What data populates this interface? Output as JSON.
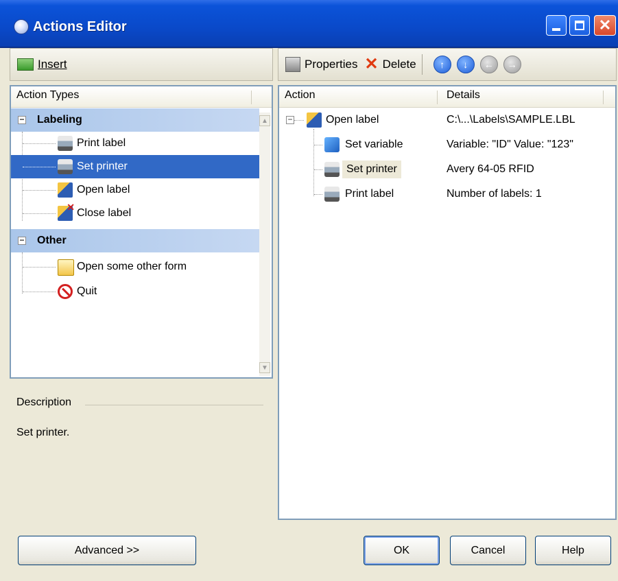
{
  "window": {
    "title": "Actions Editor"
  },
  "left_toolbar": {
    "insert_label": "Insert"
  },
  "right_toolbar": {
    "properties_label": "Properties",
    "delete_label": "Delete"
  },
  "action_types": {
    "header": "Action Types",
    "groups": [
      {
        "label": "Labeling",
        "items": [
          "Print label",
          "Set printer",
          "Open label",
          "Close label"
        ]
      },
      {
        "label": "Other",
        "items": [
          "Open some other form",
          "Quit"
        ]
      }
    ],
    "selected_item": "Set printer"
  },
  "description": {
    "title": "Description",
    "text": "Set printer."
  },
  "actions": {
    "columns": [
      "Action",
      "Details"
    ],
    "rows": [
      {
        "action": "Open label",
        "details": "C:\\...\\Labels\\SAMPLE.LBL"
      },
      {
        "action": "Set variable",
        "details": "Variable: \"ID\" Value: \"123\""
      },
      {
        "action": "Set printer",
        "details": "Avery 64-05 RFID"
      },
      {
        "action": "Print label",
        "details": "Number of labels: 1"
      }
    ]
  },
  "buttons": {
    "advanced": "Advanced >>",
    "ok": "OK",
    "cancel": "Cancel",
    "help": "Help"
  }
}
